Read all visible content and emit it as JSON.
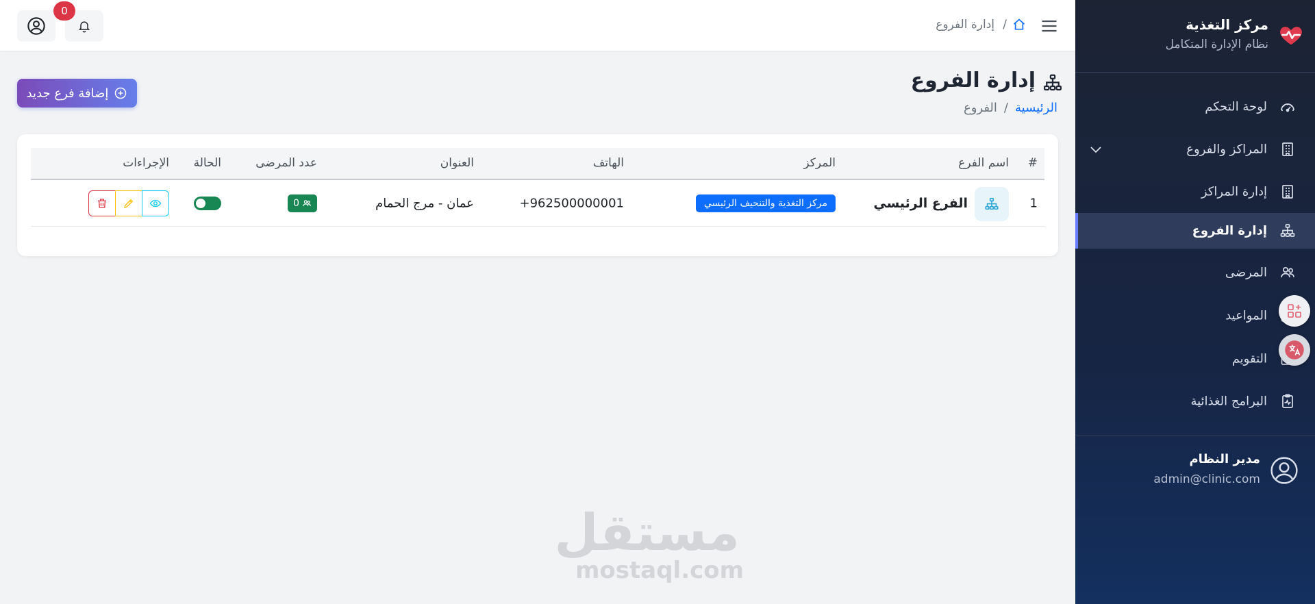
{
  "header": {
    "breadcrumb_current": "إدارة الفروع",
    "breadcrumb_sep": "/",
    "notifications_count": "0"
  },
  "sidebar": {
    "brand_title": "مركز التغذية",
    "brand_subtitle": "نظام الإدارة المتكامل",
    "items": [
      {
        "label": "لوحة التحكم",
        "icon": "speedometer-icon"
      },
      {
        "label": "المراكز والفروع",
        "icon": "building-icon",
        "expandable": true
      },
      {
        "label": "إدارة المراكز",
        "icon": "building-icon"
      },
      {
        "label": "إدارة الفروع",
        "icon": "sitemap-icon",
        "active": true
      },
      {
        "label": "المرضى",
        "icon": "people-icon"
      },
      {
        "label": "المواعيد",
        "icon": "calendar-icon"
      },
      {
        "label": "التقويم",
        "icon": "calendar-icon"
      },
      {
        "label": "البرامج الغذائية",
        "icon": "clipboard-pulse-icon"
      }
    ],
    "user": {
      "name": "مدير النظام",
      "email": "admin@clinic.com"
    }
  },
  "page": {
    "title": "إدارة الفروع",
    "breadcrumb_home": "الرئيسية",
    "breadcrumb_sep": "/",
    "breadcrumb_current": "الفروع",
    "add_button": "إضافة فرع جديد"
  },
  "table": {
    "columns": [
      "#",
      "اسم الفرع",
      "المركز",
      "الهاتف",
      "العنوان",
      "عدد المرضى",
      "الحالة",
      "الإجراءات"
    ],
    "rows": [
      {
        "index": "1",
        "name": "الفرع الرئيسي",
        "center": "مركز التغذية والتنحيف الرئيسي",
        "phone": "962500000001+",
        "address": "عمان - مرج الحمام",
        "patients": "0",
        "status_active": true
      }
    ]
  },
  "watermark": {
    "ar": "مستقل",
    "en": "mostaql.com"
  },
  "colors": {
    "sidebar_top": "#1c2333",
    "sidebar_bottom": "#13305f",
    "primary": "#0d6efd",
    "success": "#198754",
    "danger": "#dc3545",
    "warning": "#ffc107",
    "info": "#0dcaf0",
    "accent_gradient_start": "#7b4bb8",
    "accent_gradient_end": "#667eea",
    "brand_heart": "#e03a4e"
  }
}
